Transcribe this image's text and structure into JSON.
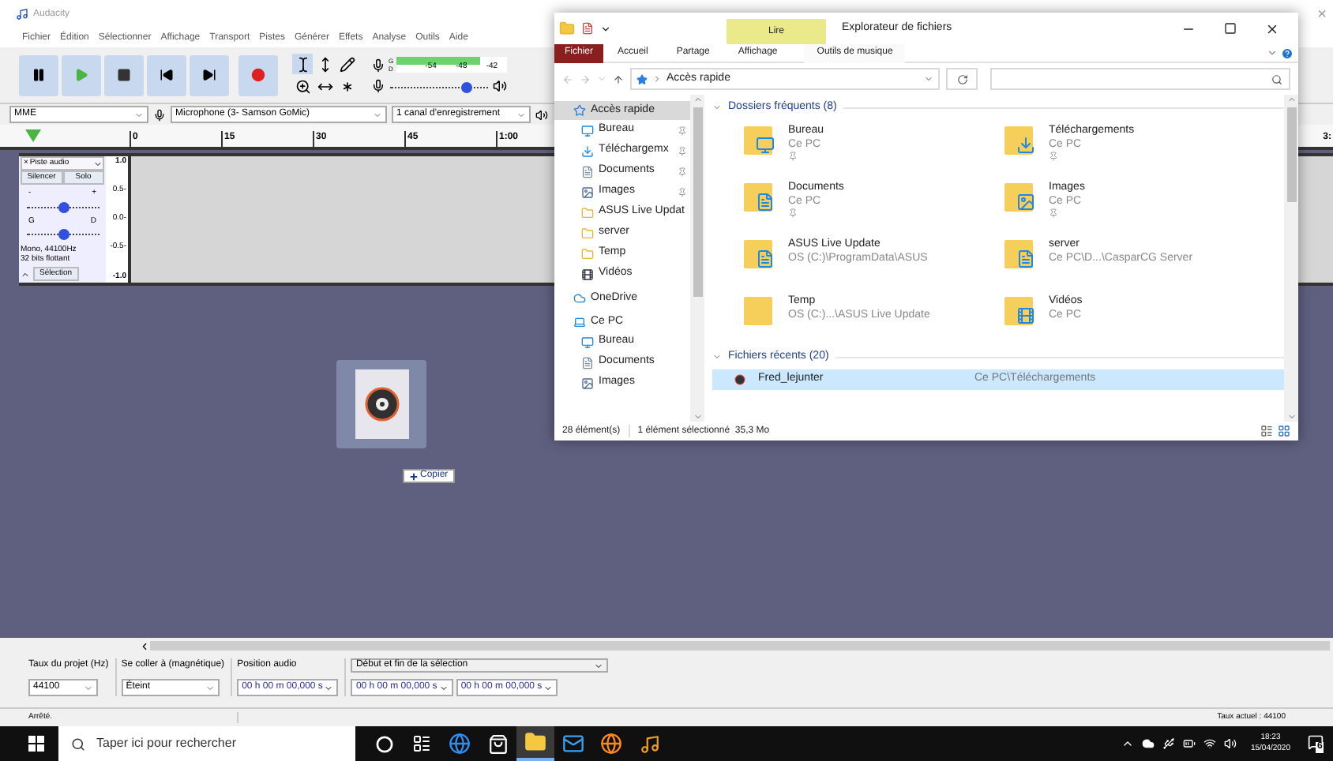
{
  "audacity": {
    "title": "Audacity",
    "close": "×",
    "menu": [
      "Fichier",
      "Édition",
      "Sélectionner",
      "Affichage",
      "Transport",
      "Pistes",
      "Générer",
      "Effets",
      "Analyse",
      "Outils",
      "Aide"
    ],
    "transport": [
      {
        "kind": "pause"
      },
      {
        "kind": "play"
      },
      {
        "kind": "stop"
      },
      {
        "kind": "start"
      },
      {
        "kind": "end"
      },
      {
        "kind": "record"
      }
    ],
    "meter": {
      "channels": [
        "G",
        "D"
      ],
      "ticks": [
        "-54",
        "-48",
        "-42"
      ],
      "level": 0.75
    },
    "playback_volume": {
      "level": 0.77
    },
    "device": {
      "host": "MME",
      "input": "Microphone (3- Samson GoMic)",
      "channels": "1 canal d'enregistrement"
    },
    "ruler": {
      "ticks": [
        "0",
        "15",
        "30",
        "45",
        "1:00"
      ],
      "edge_label": "3:"
    },
    "track": {
      "name": "Piste audio",
      "close": "×",
      "mute": "Silencer",
      "solo": "Solo",
      "gain": {
        "labels": [
          "-",
          "+"
        ],
        "level": 0.5
      },
      "pan": {
        "labels": [
          "G",
          "D"
        ],
        "level": 0.5
      },
      "info": [
        "Mono, 44100Hz",
        "32 bits flottant"
      ],
      "select": "Sélection",
      "scale": [
        "1.0",
        "0.5-",
        "0.0-",
        "-0.5-",
        "-1.0"
      ]
    },
    "selection_bar": {
      "rate_label": "Taux du projet (Hz)",
      "rate": "44100",
      "snap_label": "Se coller à (magnétique)",
      "snap": "Éteint",
      "position_label": "Position audio",
      "position": "00 h 00 m 00,000 s",
      "range_label": "Début et fin de la sélection",
      "start": "00 h 00 m 00,000 s",
      "end": "00 h 00 m 00,000 s"
    },
    "status": "Arrêté.",
    "rate_status": "Taux actuel : 44100"
  },
  "drag": {
    "label": "Copier"
  },
  "explorer": {
    "title": "Explorateur de fichiers",
    "context_label": "Lire",
    "tabs": [
      {
        "label": "Fichier",
        "kind": "file"
      },
      {
        "label": "Accueil",
        "kind": "normal"
      },
      {
        "label": "Partage",
        "kind": "normal"
      },
      {
        "label": "Affichage",
        "kind": "normal"
      },
      {
        "label": "Outils de musique",
        "kind": "context"
      }
    ],
    "address": "Accès rapide",
    "nav": [
      {
        "label": "Accès rapide",
        "kind": "star",
        "selected": true,
        "children": [
          {
            "label": "Bureau",
            "kind": "desktop",
            "pinned": true,
            "selected": false
          },
          {
            "label": "Téléchargemx",
            "kind": "download",
            "pinned": true,
            "selected": false
          },
          {
            "label": "Documents",
            "kind": "document",
            "pinned": true,
            "selected": false
          },
          {
            "label": "Images",
            "kind": "image",
            "pinned": true,
            "selected": false
          },
          {
            "label": "ASUS Live Updat",
            "kind": "folder",
            "pinned": false,
            "selected": false
          },
          {
            "label": "server",
            "kind": "folder",
            "pinned": false,
            "selected": false
          },
          {
            "label": "Temp",
            "kind": "folder",
            "pinned": false,
            "selected": false
          },
          {
            "label": "Vidéos",
            "kind": "video",
            "pinned": false,
            "selected": false
          }
        ]
      },
      {
        "label": "OneDrive",
        "kind": "cloud",
        "selected": false
      },
      {
        "label": "Ce PC",
        "kind": "pc",
        "selected": false,
        "children": [
          {
            "label": "Bureau",
            "kind": "desktop",
            "pinned": false,
            "selected": false
          },
          {
            "label": "Documents",
            "kind": "document",
            "pinned": false,
            "selected": false
          },
          {
            "label": "Images",
            "kind": "image",
            "pinned": false,
            "selected": false
          }
        ]
      }
    ],
    "frequent_header": "Dossiers fréquents (8)",
    "frequent": [
      {
        "name": "Bureau",
        "location": "Ce PC",
        "pinned": true,
        "kind": "desktop"
      },
      {
        "name": "Téléchargements",
        "location": "Ce PC",
        "pinned": true,
        "kind": "download"
      },
      {
        "name": "Documents",
        "location": "Ce PC",
        "pinned": true,
        "kind": "document"
      },
      {
        "name": "Images",
        "location": "Ce PC",
        "pinned": true,
        "kind": "image"
      },
      {
        "name": "ASUS Live Update",
        "location": "OS (C:)\\ProgramData\\ASUS",
        "pinned": false,
        "kind": "files"
      },
      {
        "name": "server",
        "location": "Ce PC\\D...\\CasparCG Server",
        "pinned": false,
        "kind": "files"
      },
      {
        "name": "Temp",
        "location": "OS (C:)...\\ASUS Live Update",
        "pinned": false,
        "kind": "folder"
      },
      {
        "name": "Vidéos",
        "location": "Ce PC",
        "pinned": false,
        "kind": "video"
      }
    ],
    "recent_header": "Fichiers récents (20)",
    "recent": [
      {
        "name": "Fred_lejunter",
        "location": "Ce PC\\Téléchargements",
        "selected": true
      }
    ],
    "status_count": "28 élément(s)",
    "status_selection": "1 élément sélectionné  35,3 Mo"
  },
  "taskbar": {
    "search": "Taper ici pour rechercher",
    "apps": [
      {
        "kind": "cortana",
        "selected": false
      },
      {
        "kind": "taskview",
        "selected": false
      },
      {
        "kind": "edge",
        "selected": false
      },
      {
        "kind": "store",
        "selected": false
      },
      {
        "kind": "explorer",
        "selected": true
      },
      {
        "kind": "mail",
        "selected": false
      },
      {
        "kind": "firefox",
        "selected": false
      },
      {
        "kind": "audacity",
        "selected": false
      }
    ],
    "time": "18:23",
    "date": "15/04/2020",
    "notifications": "6"
  }
}
